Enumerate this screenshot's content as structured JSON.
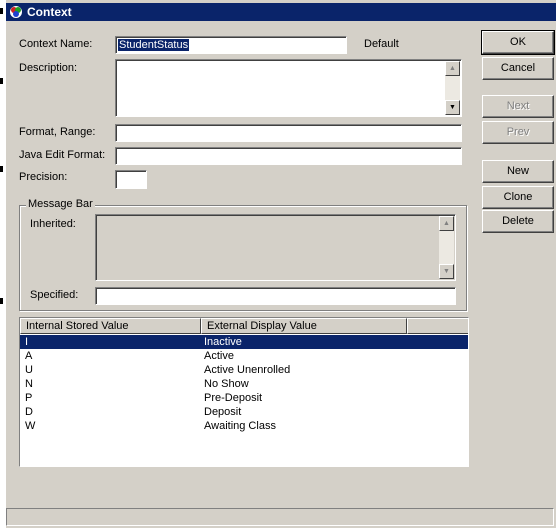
{
  "window": {
    "title": "Context"
  },
  "form": {
    "context_name_label": "Context Name:",
    "context_name_value": "StudentStatus",
    "default_label": "Default",
    "description_label": "Description:",
    "description_value": "",
    "format_range_label": "Format, Range:",
    "format_range_value": "",
    "java_edit_format_label": "Java Edit Format:",
    "java_edit_format_value": "",
    "precision_label": "Precision:",
    "precision_value": ""
  },
  "message_bar": {
    "title": "Message Bar",
    "inherited_label": "Inherited:",
    "inherited_value": "",
    "specified_label": "Specified:",
    "specified_value": ""
  },
  "buttons": {
    "ok": "OK",
    "cancel": "Cancel",
    "next": "Next",
    "prev": "Prev",
    "new": "New",
    "clone": "Clone",
    "delete": "Delete"
  },
  "table": {
    "columns": [
      "Internal Stored Value",
      "External Display Value"
    ],
    "rows": [
      {
        "internal": "I",
        "external": "Inactive"
      },
      {
        "internal": "A",
        "external": "Active"
      },
      {
        "internal": "U",
        "external": "Active Unenrolled"
      },
      {
        "internal": "N",
        "external": "No Show"
      },
      {
        "internal": "P",
        "external": "Pre-Deposit"
      },
      {
        "internal": "D",
        "external": "Deposit"
      },
      {
        "internal": "W",
        "external": "Awaiting Class"
      }
    ],
    "selected_row": 0
  },
  "icons": {
    "title_icon": "app-icon",
    "scroll_up": "scroll-up-arrow-icon",
    "scroll_down": "scroll-down-arrow-icon"
  },
  "colors": {
    "title_bar": "#0a246a",
    "face": "#d4d0c8",
    "selection": "#0a246a"
  }
}
